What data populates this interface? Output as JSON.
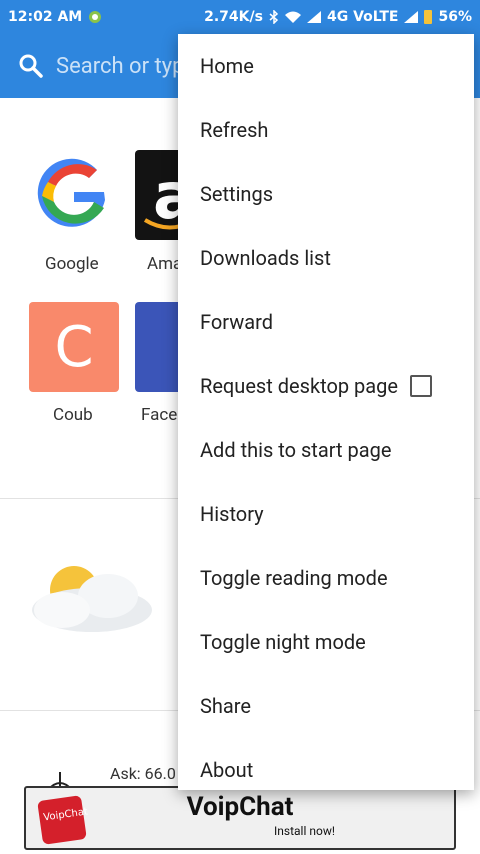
{
  "status_bar": {
    "time": "12:02 AM",
    "speed": "2.74K/s",
    "network": "4G VoLTE",
    "battery": "56%"
  },
  "search": {
    "placeholder": "Search or type URL"
  },
  "speed_dial": [
    {
      "label": "Google"
    },
    {
      "label": "Ama"
    },
    {
      "label": "Coub",
      "letter": "C"
    },
    {
      "label": "Face"
    }
  ],
  "news": {
    "ask_text": "Ask: 66.0"
  },
  "ad": {
    "logo_text": "VoipChat",
    "title": "VoipChat",
    "subtitle": "Install now!"
  },
  "menu": {
    "items": [
      {
        "label": "Home"
      },
      {
        "label": "Refresh"
      },
      {
        "label": "Settings"
      },
      {
        "label": "Downloads list"
      },
      {
        "label": "Forward"
      },
      {
        "label": "Request desktop page"
      },
      {
        "label": "Add this to start page"
      },
      {
        "label": "History"
      },
      {
        "label": "Toggle reading mode"
      },
      {
        "label": "Toggle night mode"
      },
      {
        "label": "Share"
      },
      {
        "label": "About"
      }
    ],
    "desktop_checked": false
  },
  "colors": {
    "accent": "#2e86de",
    "coub": "#f9896b",
    "facebook": "#3b55b8",
    "ad_logo": "#d4202b"
  }
}
